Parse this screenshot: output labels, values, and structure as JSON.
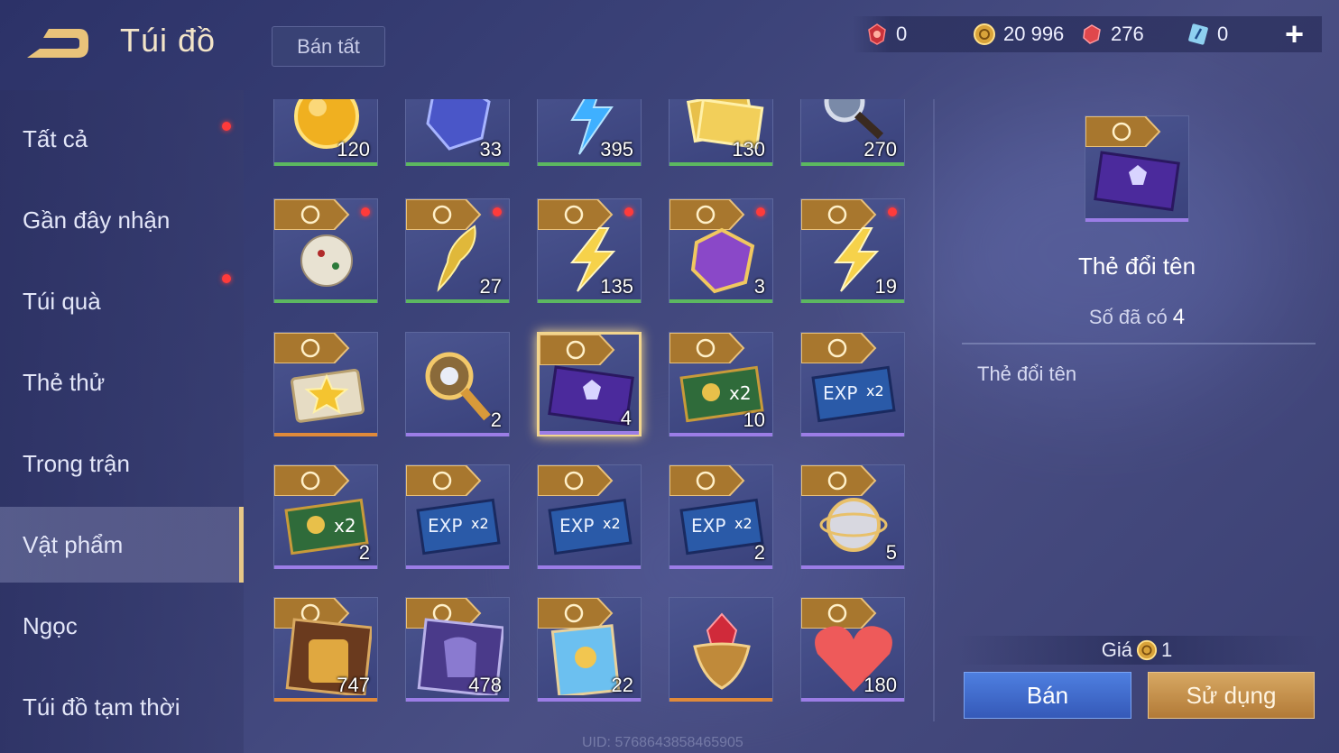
{
  "header": {
    "title": "Túi đồ",
    "sell_all": "Bán tất",
    "add": "+"
  },
  "currency": {
    "c1": "0",
    "coins": "20 996",
    "gems": "276",
    "c4": "0"
  },
  "sidebar": {
    "items": [
      {
        "label": "Tất cả"
      },
      {
        "label": "Gần đây nhận"
      },
      {
        "label": "Túi quà"
      },
      {
        "label": "Thẻ thử"
      },
      {
        "label": "Trong trận"
      },
      {
        "label": "Vật phẩm"
      },
      {
        "label": "Ngọc"
      },
      {
        "label": "Túi đồ tạm thời"
      }
    ]
  },
  "grid": {
    "r0": [
      "120",
      "33",
      "395",
      "130",
      "270"
    ],
    "r1": [
      "",
      "27",
      "135",
      "3",
      "19"
    ],
    "r2": [
      "",
      "2",
      "4",
      "10",
      ""
    ],
    "r3": [
      "2",
      "",
      "",
      "2",
      "5"
    ],
    "r4": [
      "747",
      "478",
      "22",
      "",
      "180"
    ]
  },
  "detail": {
    "name": "Thẻ đổi tên",
    "owned_label": "Số đã có",
    "owned_value": "4",
    "description": "Thẻ đổi tên",
    "price_label": "Giá",
    "price_value": "1",
    "sell_button": "Bán",
    "use_button": "Sử dụng"
  },
  "footer": {
    "uid": "UID: 5768643858465905"
  },
  "colors": {
    "accent_gold": "#e7c887",
    "rarity_green": "#5cb860",
    "rarity_orange": "#e08a3a",
    "rarity_purple": "#9b7de6",
    "sell_blue": "#4e7fe0",
    "use_gold": "#d7a863"
  }
}
